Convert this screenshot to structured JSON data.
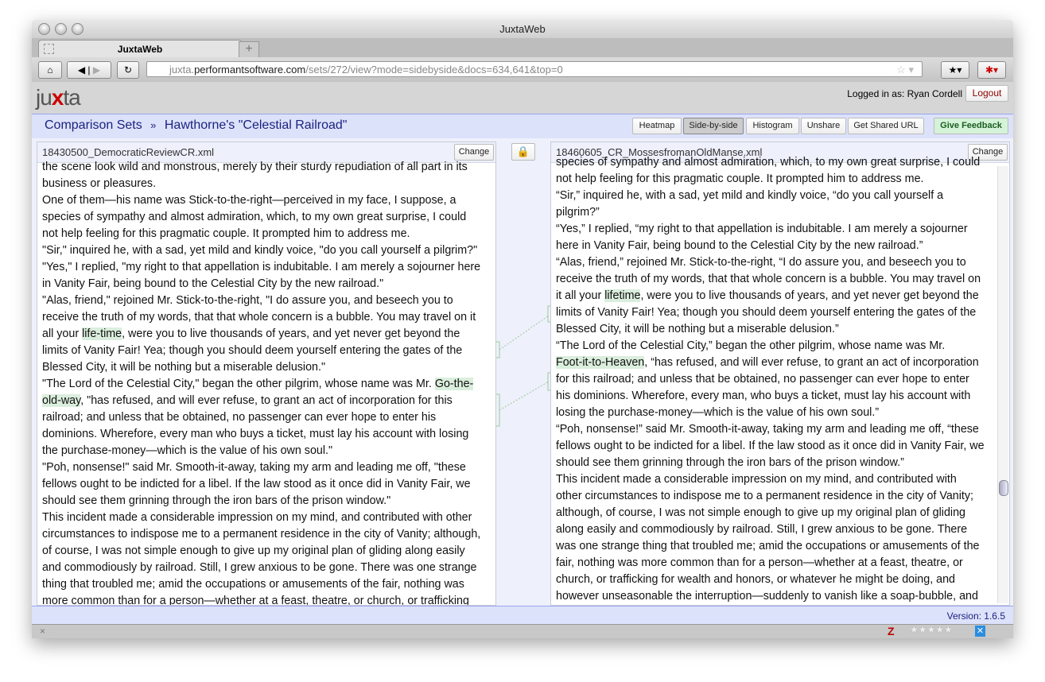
{
  "browser": {
    "window_title": "JuxtaWeb",
    "tab_label": "JuxtaWeb",
    "new_tab": "+",
    "url_prefix": "juxta.",
    "url_domain": "performantsoftware.com",
    "url_path": "/sets/272/view?mode=sidebyside&docs=634,641&top=0"
  },
  "app": {
    "logo_pre": "ju",
    "logo_x": "x",
    "logo_post": "ta",
    "logged_in": "Logged in as: Ryan Cordell",
    "logout": "Logout"
  },
  "nav": {
    "breadcrumb_root": "Comparison Sets",
    "separator": "»",
    "set_name": "Hawthorne's \"Celestial Railroad\"",
    "buttons": [
      "Heatmap",
      "Side-by-side",
      "Histogram",
      "Unshare",
      "Get Shared URL"
    ],
    "feedback": "Give Feedback"
  },
  "left": {
    "filename": "18430500_DemocraticReviewCR.xml",
    "change": "Change",
    "lines": [
      "the scene look wild and monstrous, merely by their sturdy repudiation of all part in its",
      "business or pleasures.",
      "One of them—his name was Stick-to-the-right—perceived in my face, I suppose, a",
      "species of sympathy and almost admiration, which, to my own great surprise, I could",
      "not help feeling for this pragmatic couple. It prompted him to address me.",
      "\"Sir,\" inquired he, with a sad, yet mild and kindly voice, \"do you call yourself a pilgrim?\"",
      "\"Yes,\" I replied, \"my right to that appellation is indubitable. I am merely a sojourner here",
      "in Vanity Fair, being bound to the Celestial City by the new railroad.\"",
      "\"Alas, friend,\" rejoined Mr. Stick-to-the-right, \"I do assure you, and beseech you to",
      "receive the truth of my words, that that whole concern is a bubble. You may travel on it",
      {
        "pre": "all your ",
        "hl": "life-time",
        "post": ", were you to live thousands of years, and yet never get beyond the"
      },
      "limits of Vanity Fair! Yea; though you should deem yourself entering the gates of the",
      "Blessed City, it will be nothing but a miserable delusion.\"",
      {
        "pre": "\"The Lord of the Celestial City,\" began the other pilgrim, whose name was Mr. ",
        "hl": "Go-the-",
        "post": ""
      },
      {
        "pre": "",
        "hl": "old-way",
        "post": ", \"has refused, and will ever refuse, to grant an act of incorporation for this"
      },
      "railroad; and unless that be obtained, no passenger can ever hope to enter his",
      "dominions. Wherefore, every man who buys a ticket, must lay his account with losing",
      "the purchase-money—which is the value of his own soul.\"",
      "\"Poh, nonsense!\" said Mr. Smooth-it-away, taking my arm and leading me off, \"these",
      "fellows ought to be indicted for a libel. If the law stood as it once did in Vanity Fair, we",
      "should see them grinning through the iron bars of the prison window.\"",
      "This incident made a considerable impression on my mind, and contributed with other",
      "circumstances to indispose me to a permanent residence in the city of Vanity; although,",
      "of course, I was not simple enough to give up my original plan of gliding along easily",
      "and commodiously by railroad. Still, I grew anxious to be gone. There was one strange",
      "thing that troubled me; amid the occupations or amusements of the fair, nothing was",
      "more common than for a person—whether at a feast, theatre, or church, or trafficking"
    ]
  },
  "right": {
    "filename": "18460605_CR_MossesfromanOldManse.xml",
    "change": "Change",
    "lines": [
      "species of sympathy and almost admiration, which, to my own great surprise, I could",
      "not help feeling for this pragmatic couple. It prompted him to address me.",
      "“Sir,” inquired he, with a sad, yet mild and kindly voice, “do you call yourself a",
      "pilgrim?”",
      "“Yes,” I replied, “my right to that appellation is indubitable. I am merely a sojourner",
      "here in Vanity Fair, being bound to the Celestial City by the new railroad.”",
      "“Alas, friend,” rejoined Mr. Stick-to-the-right, “I do assure you, and beseech you to",
      "receive the truth of my words, that that whole concern is a bubble. You may travel on",
      {
        "pre": "it all your ",
        "hl": "lifetime",
        "post": ", were you to live thousands of years, and yet never get beyond the"
      },
      "limits of Vanity Fair! Yea; though you should deem yourself entering the gates of the",
      "Blessed City, it will be nothing but a miserable delusion.”",
      "“The Lord of the Celestial City,” began the other pilgrim, whose name was Mr.",
      {
        "pre": "",
        "hl": "Foot-it-to-Heaven",
        "post": ", “has refused, and will ever refuse, to grant an act of incorporation"
      },
      "for this railroad; and unless that be obtained, no passenger can ever hope to enter",
      "his dominions. Wherefore, every man, who buys a ticket, must lay his account with",
      "losing the purchase-money—which is the value of his own soul.”",
      "“Poh, nonsense!” said Mr. Smooth-it-away, taking my arm and leading me off, “these",
      "fellows ought to be indicted for a libel. If the law stood as it once did in Vanity Fair, we",
      "should see them grinning through the iron bars of the prison window.”",
      "This incident made a considerable impression on my mind, and contributed with",
      "other circumstances to indispose me to a permanent residence in the city of Vanity;",
      "although, of course, I was not simple enough to give up my original plan of gliding",
      "along easily and commodiously by railroad. Still, I grew anxious to be gone. There",
      "was one strange thing that troubled me; amid the occupations or amusements of the",
      "fair, nothing was more common than for a person—whether at a feast, theatre, or",
      "church, or trafficking for wealth and honors, or whatever he might be doing, and",
      "however unseasonable the interruption—suddenly to vanish like a soap-bubble, and"
    ]
  },
  "footer": {
    "version": "Version: 1.6.5"
  },
  "status": {
    "close": "×",
    "z": "Z"
  },
  "colors": {
    "highlight": "#dbeedd",
    "nav_bg": "#dde2fb",
    "link": "#1a237e",
    "logout": "#8b0000",
    "feedback_bg": "#d4f3d8"
  }
}
